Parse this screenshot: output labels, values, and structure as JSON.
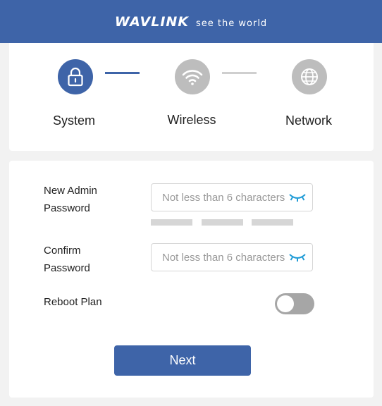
{
  "header": {
    "logo": "WAVLINK",
    "tagline": "see the world"
  },
  "steps": [
    {
      "label": "System",
      "icon": "lock-icon",
      "state": "active"
    },
    {
      "label": "Wireless",
      "icon": "wifi-icon",
      "state": "inactive"
    },
    {
      "label": "Network",
      "icon": "globe-icon",
      "state": "inactive"
    }
  ],
  "form": {
    "admin_password": {
      "label_line1": "New Admin",
      "label_line2": "Password",
      "placeholder": "Not less than 6 characters",
      "value": ""
    },
    "password_strength_segments": 3,
    "confirm_password": {
      "label_line1": "Confirm",
      "label_line2": "Password",
      "placeholder": "Not less than 6 characters",
      "value": ""
    },
    "reboot_plan": {
      "label": "Reboot Plan",
      "enabled": false
    },
    "next_label": "Next"
  },
  "colors": {
    "brand_blue": "#3e64a8",
    "inactive_gray": "#bdbdbd",
    "eye_icon": "#1f9bd6"
  }
}
